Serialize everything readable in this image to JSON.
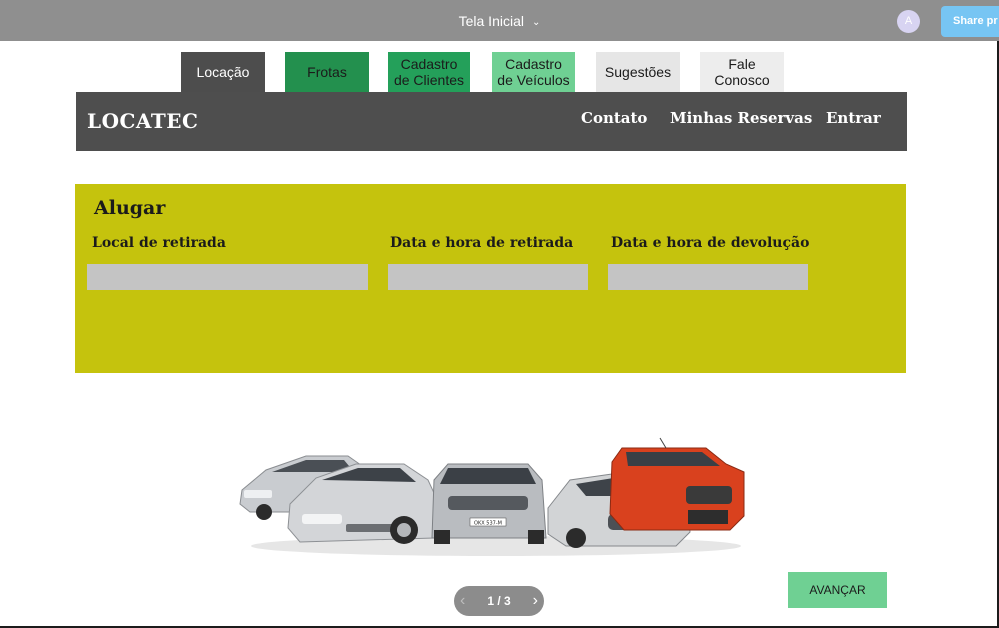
{
  "topbar": {
    "title": "Tela Inicial",
    "avatar": "A",
    "share_label": "Share pr"
  },
  "tabs": [
    {
      "label": "Locação",
      "color": "#4d4d4d"
    },
    {
      "label": "Frotas",
      "color": "#23904e"
    },
    {
      "label": "Cadastro\nde Clientes",
      "color": "#24a05a"
    },
    {
      "label": "Cadastro\nde Veículos",
      "color": "#6fd093"
    },
    {
      "label": "Sugestões",
      "color": "#e6e6e6"
    },
    {
      "label": "Fale\nConosco",
      "color": "#ededed"
    }
  ],
  "header": {
    "logo": "LOCATEC",
    "nav": [
      "Contato",
      "Minhas Reservas",
      "Entrar"
    ]
  },
  "rent": {
    "title": "Alugar",
    "panel_color": "#c5c30d",
    "fields": [
      {
        "label": "Local de retirada",
        "value": ""
      },
      {
        "label": "Data e hora de retirada",
        "value": ""
      },
      {
        "label": "Data e hora de devolução",
        "value": ""
      }
    ]
  },
  "cars_image": {
    "plate": "OKX 537-M",
    "colors": [
      "#c9ccd0",
      "#d3d5d8",
      "#b9bcc0",
      "#d2d4d6",
      "#d9411e"
    ]
  },
  "pager": {
    "page": "1 / 3"
  },
  "actions": {
    "advance_label": "AVANÇAR",
    "advance_color": "#6fd093"
  }
}
